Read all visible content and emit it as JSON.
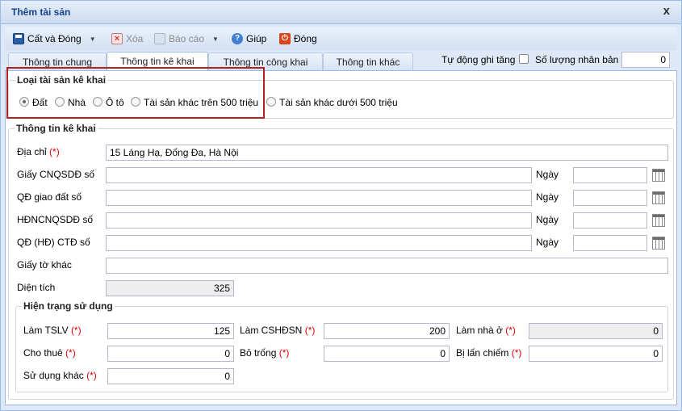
{
  "window": {
    "title": "Thêm tài sản",
    "close_glyph": "x"
  },
  "toolbar": {
    "save_close": "Cất và Đóng",
    "delete": "Xóa",
    "report": "Báo cáo",
    "help": "Giúp",
    "close": "Đóng"
  },
  "tabs": [
    "Thông tin chung",
    "Thông tin kê khai",
    "Thông tin công khai",
    "Thông tin khác"
  ],
  "active_tab": "Thông tin kê khai",
  "auto_increase": {
    "label": "Tự động ghi tăng",
    "checked": false
  },
  "copies": {
    "label": "Số lượng nhân bản",
    "value": "0"
  },
  "asset_type": {
    "legend": "Loại tài sản kê khai",
    "options": [
      "Đất",
      "Nhà",
      "Ô tô",
      "Tài sản khác trên 500 triệu",
      "Tài sản khác dưới 500 triệu"
    ],
    "selected": "Đất"
  },
  "declaration": {
    "legend": "Thông tin kê khai",
    "address": {
      "label": "Địa chỉ",
      "req": "(*)",
      "value": "15 Láng Hạ, Đống Đa, Hà Nội"
    },
    "rows": [
      {
        "label": "Giấy CNQSDĐ số",
        "value": "",
        "date_label": "Ngày",
        "date": ""
      },
      {
        "label": "QĐ giao đất số",
        "value": "",
        "date_label": "Ngày",
        "date": ""
      },
      {
        "label": "HĐNCNQSDĐ số",
        "value": "",
        "date_label": "Ngày",
        "date": ""
      },
      {
        "label": "QĐ (HĐ) CTĐ số",
        "value": "",
        "date_label": "Ngày",
        "date": ""
      }
    ],
    "other_docs": {
      "label": "Giấy tờ khác",
      "value": ""
    },
    "area": {
      "label": "Diện tích",
      "value": "325"
    }
  },
  "usage": {
    "legend": "Hiện trạng sử dụng",
    "fields": [
      {
        "label": "Làm TSLV",
        "req": "(*)",
        "value": "125"
      },
      {
        "label": "Làm CSHĐSN",
        "req": "(*)",
        "value": "200"
      },
      {
        "label": "Làm nhà ở",
        "req": "(*)",
        "value": "0"
      },
      {
        "label": "Cho thuê",
        "req": "(*)",
        "value": "0"
      },
      {
        "label": "Bỏ trống",
        "req": "(*)",
        "value": "0"
      },
      {
        "label": "Bị lấn chiếm",
        "req": "(*)",
        "value": "0"
      },
      {
        "label": "Sử dụng khác",
        "req": "(*)",
        "value": "0"
      }
    ]
  },
  "colors": {
    "title": "#15428b",
    "border": "#99bbe8",
    "required": "#dd0000",
    "highlight": "#b22222"
  }
}
